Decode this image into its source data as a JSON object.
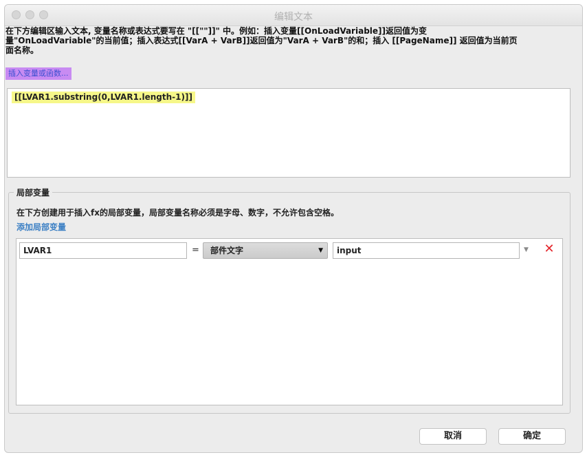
{
  "window": {
    "title": "编辑文本"
  },
  "instructions": {
    "line1": "在下方编辑区输入文本, 变量名称或表达式要写在 \"[[\"\"]]\" 中。例如：插入变量[[OnLoadVariable]]返回值为变",
    "line2": "量\"OnLoadVariable\"的当前值；插入表达式[[VarA + VarB]]返回值为\"VarA + VarB\"的和；插入 [[PageName]] 返回值为当前页",
    "line3": "面名称。"
  },
  "insert_link": {
    "label": "插入变量或函数..."
  },
  "editor": {
    "text": "[[LVAR1.substring(0,LVAR1.length-1)]]"
  },
  "local_variables": {
    "title": "局部变量",
    "description": "在下方创建用于插入fx的局部变量，局部变量名称必须是字母、数字，不允许包含空格。",
    "add_label": "添加局部变量",
    "rows": [
      {
        "name": "LVAR1",
        "equals": "=",
        "type": "部件文字",
        "value": "input",
        "delete_icon": "delete-x-icon"
      }
    ]
  },
  "buttons": {
    "cancel": "取消",
    "ok": "确定"
  },
  "colors": {
    "highlight_editor": "#f6f789",
    "highlight_insert_link": "#c88bf2",
    "link": "#3b7fc4",
    "delete": "#e4262c"
  }
}
